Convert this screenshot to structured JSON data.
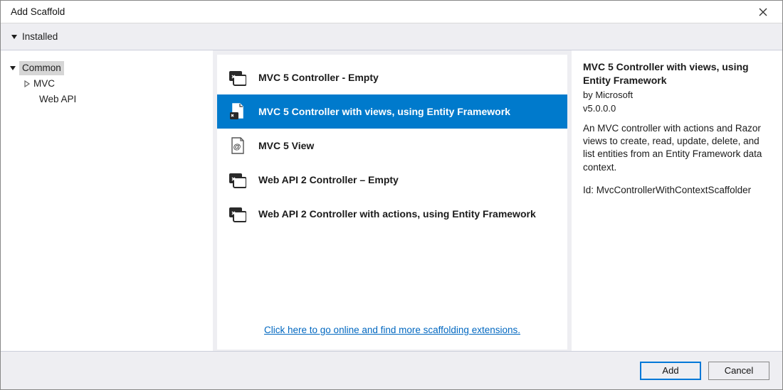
{
  "window": {
    "title": "Add Scaffold"
  },
  "toolbar": {
    "installed": "Installed"
  },
  "sidebar": {
    "items": [
      {
        "label": "Common",
        "selected": true,
        "expandable": true
      },
      {
        "label": "MVC",
        "selected": false,
        "expandable": true
      },
      {
        "label": "Web API",
        "selected": false,
        "expandable": false
      }
    ]
  },
  "list": {
    "items": [
      {
        "label": "MVC 5 Controller - Empty",
        "selected": false,
        "icon": "controller"
      },
      {
        "label": "MVC 5 Controller with views, using Entity Framework",
        "selected": true,
        "icon": "doc-controller"
      },
      {
        "label": "MVC 5 View",
        "selected": false,
        "icon": "view"
      },
      {
        "label": "Web API 2 Controller – Empty",
        "selected": false,
        "icon": "controller"
      },
      {
        "label": "Web API 2 Controller with actions, using Entity Framework",
        "selected": false,
        "icon": "controller"
      }
    ],
    "footer_link": "Click here to go online and find more scaffolding extensions."
  },
  "details": {
    "title": "MVC 5 Controller with views, using Entity Framework",
    "by": "by Microsoft",
    "version": "v5.0.0.0",
    "description": "An MVC controller with actions and Razor views to create, read, update, delete, and list entities from an Entity Framework data context.",
    "id_label": "Id: ",
    "id_value": "MvcControllerWithContextScaffolder"
  },
  "buttons": {
    "add": "Add",
    "cancel": "Cancel"
  }
}
